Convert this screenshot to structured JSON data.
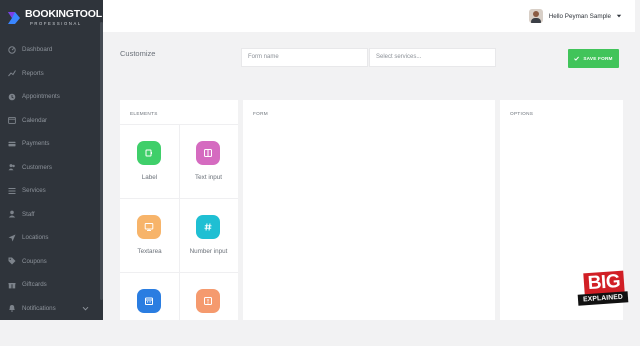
{
  "brand": {
    "name": "BOOKINGTOOL",
    "sub": "PROFESSIONAL",
    "accent": "#3a86ff"
  },
  "sidebar": {
    "items": [
      {
        "label": "Dashboard",
        "icon": "dashboard-icon"
      },
      {
        "label": "Reports",
        "icon": "chart-icon"
      },
      {
        "label": "Appointments",
        "icon": "clock-icon"
      },
      {
        "label": "Calendar",
        "icon": "calendar-icon"
      },
      {
        "label": "Payments",
        "icon": "card-icon"
      },
      {
        "label": "Customers",
        "icon": "users-icon"
      },
      {
        "label": "Services",
        "icon": "list-icon"
      },
      {
        "label": "Staff",
        "icon": "user-icon"
      },
      {
        "label": "Locations",
        "icon": "location-icon"
      },
      {
        "label": "Coupons",
        "icon": "tag-icon"
      },
      {
        "label": "Giftcards",
        "icon": "gift-icon"
      },
      {
        "label": "Notifications",
        "icon": "bell-icon"
      }
    ]
  },
  "topbar": {
    "user_name": "Hello Peyman Sample"
  },
  "toolbar": {
    "title": "Customize",
    "form_name_placeholder": "Form name",
    "services_placeholder": "Select services...",
    "save_label": "SAVE FORM",
    "save_color": "#41c45a"
  },
  "panels": {
    "elements_title": "ELEMENTS",
    "form_title": "FORM",
    "options_title": "OPTIONS"
  },
  "elements": [
    {
      "label": "Label",
      "color": "#3fcf6a",
      "icon": "label-icon"
    },
    {
      "label": "Text input",
      "color": "#d56bc0",
      "icon": "text-input-icon"
    },
    {
      "label": "Textarea",
      "color": "#f7b46a",
      "icon": "textarea-icon"
    },
    {
      "label": "Number input",
      "color": "#1fbfd3",
      "icon": "hash-icon"
    },
    {
      "label": "",
      "color": "#2a7de1",
      "icon": "date-icon"
    },
    {
      "label": "",
      "color": "#f59a6e",
      "icon": "time-icon"
    }
  ],
  "badge": {
    "big": "BIG",
    "sub": "EXPLAINED"
  }
}
